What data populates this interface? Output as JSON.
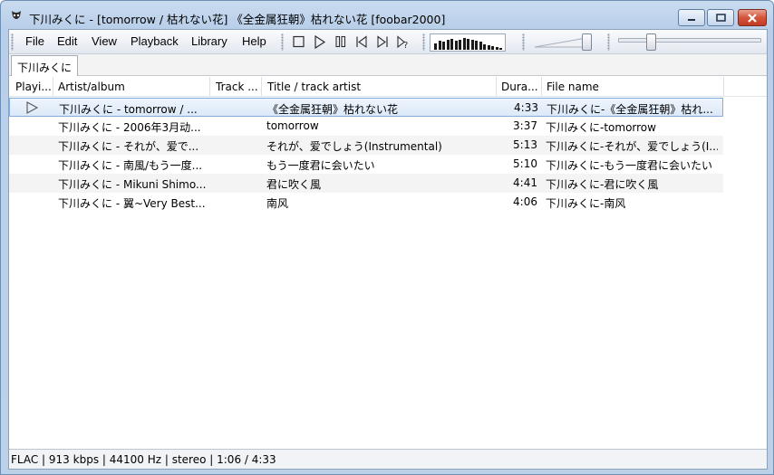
{
  "window": {
    "title": "下川みくに - [tomorrow / 枯れない花] 《全金属狂朝》枯れない花  [foobar2000]"
  },
  "menu": {
    "items": [
      "File",
      "Edit",
      "View",
      "Playback",
      "Library",
      "Help"
    ]
  },
  "toolbar": {
    "buttons": [
      "stop-icon",
      "play-icon",
      "pause-icon",
      "previous-icon",
      "next-icon",
      "random-icon"
    ],
    "visualizer_levels": [
      0.45,
      0.6,
      0.55,
      0.7,
      0.75,
      0.65,
      0.7,
      0.8,
      0.75,
      0.7,
      0.6,
      0.55,
      0.4,
      0.3,
      0.25,
      0.18,
      0.12
    ],
    "volume_level": 0.95,
    "seek_position": 0.23
  },
  "tab": {
    "label": "下川みくに"
  },
  "columns": {
    "playing": "Playi...",
    "artist": "Artist/album",
    "track": "Track ...",
    "title": "Title / track artist",
    "duration": "Dura...",
    "filename": "File name"
  },
  "rows": [
    {
      "artist": "下川みくに - tomorrow / ...",
      "track": "",
      "title": "《全金属狂朝》枯れない花",
      "duration": "4:33",
      "filename": "下川みくに-《全金属狂朝》枯れ...",
      "playing": true
    },
    {
      "artist": "下川みくに - 2006年3月动...",
      "track": "",
      "title": "tomorrow",
      "duration": "3:37",
      "filename": "下川みくに-tomorrow",
      "playing": false
    },
    {
      "artist": "下川みくに - それが、爱で...",
      "track": "",
      "title": "それが、爱でしょう(Instrumental)",
      "duration": "5:13",
      "filename": "下川みくに-それが、爱でしょう(I...",
      "playing": false
    },
    {
      "artist": "下川みくに - 南風/もう一度...",
      "track": "",
      "title": "もう一度君に会いたい",
      "duration": "5:10",
      "filename": "下川みくに-もう一度君に会いたい",
      "playing": false
    },
    {
      "artist": "下川みくに - Mikuni Shimo...",
      "track": "",
      "title": "君に吹く風",
      "duration": "4:41",
      "filename": "下川みくに-君に吹く風",
      "playing": false
    },
    {
      "artist": "下川みくに - 翼~Very Best...",
      "track": "",
      "title": "南风",
      "duration": "4:06",
      "filename": "下川みくに-南风",
      "playing": false
    }
  ],
  "status": {
    "text": "FLAC | 913 kbps | 44100 Hz | stereo | 1:06 / 4:33"
  }
}
